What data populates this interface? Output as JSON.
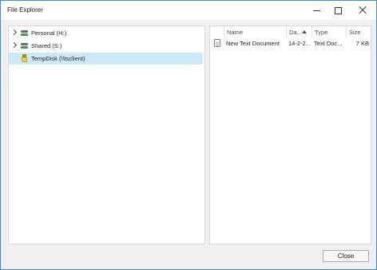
{
  "window": {
    "title": "File Explorer"
  },
  "tree": {
    "items": [
      {
        "label": "Personal (H:)",
        "icon": "network-drive-icon",
        "expandable": true,
        "selected": false
      },
      {
        "label": "Shared (S:)",
        "icon": "network-drive-icon",
        "expandable": true,
        "selected": false
      },
      {
        "label": "TempDisk (\\\\tsclient)",
        "icon": "usb-drive-icon",
        "expandable": false,
        "selected": true
      }
    ]
  },
  "list": {
    "columns": {
      "name": "Name",
      "date": "Da...",
      "type": "Type",
      "size": "Size"
    },
    "sort_column": "date",
    "files": [
      {
        "name": "New Text Document",
        "date": "14-2-2...",
        "type": "Text Doc...",
        "size": "7 KB"
      }
    ]
  },
  "buttons": {
    "close": "Close"
  },
  "colors": {
    "selection": "#cde8f7",
    "border_accent": "#3c8fd4"
  }
}
